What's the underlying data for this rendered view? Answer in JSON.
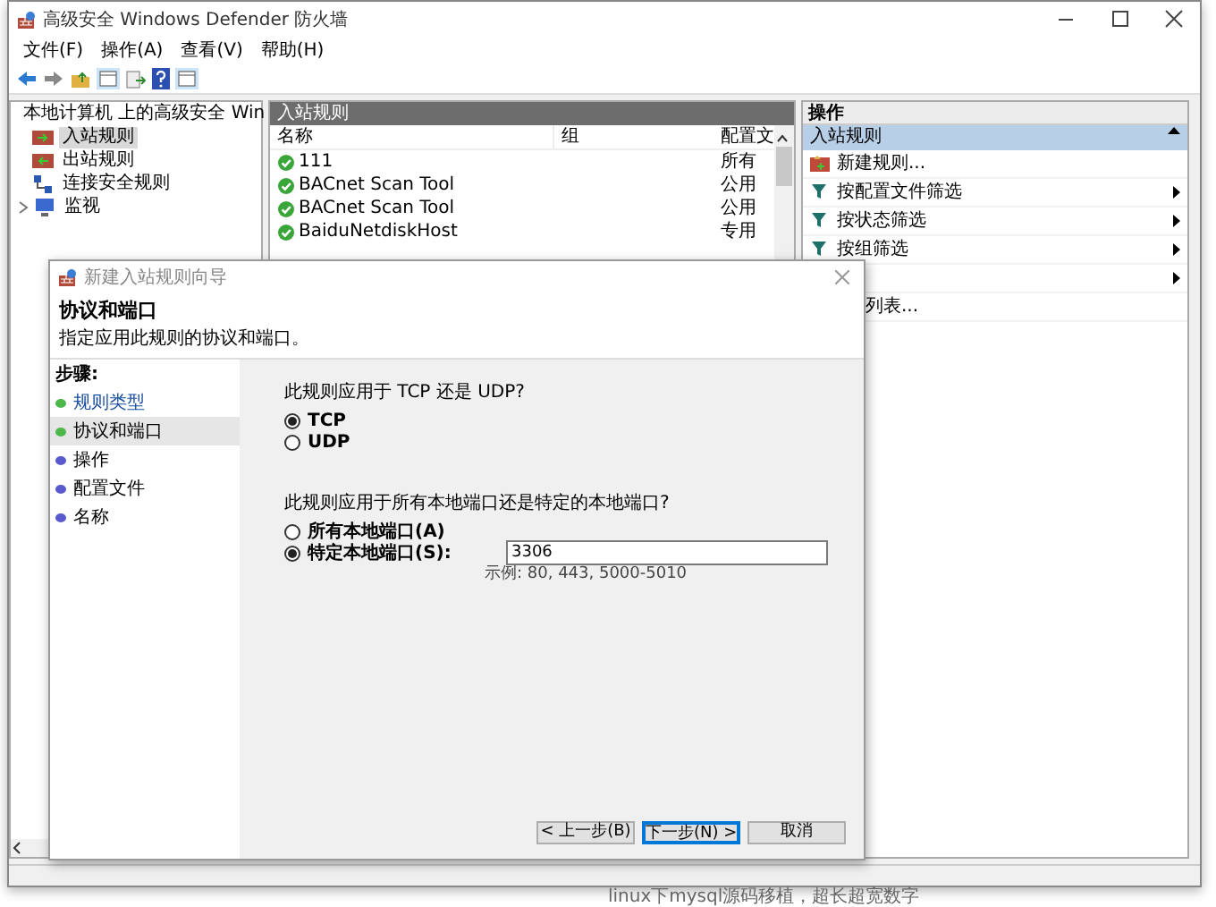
{
  "window": {
    "title": "高级安全 Windows Defender 防火墙"
  },
  "menu": [
    "文件(F)",
    "操作(A)",
    "查看(V)",
    "帮助(H)"
  ],
  "tree": {
    "root": "本地计算机 上的高级安全 Win",
    "items": [
      {
        "label": "入站规则",
        "selected": true,
        "kind": "inbound"
      },
      {
        "label": "出站规则",
        "selected": false,
        "kind": "outbound"
      },
      {
        "label": "连接安全规则",
        "selected": false,
        "kind": "security"
      },
      {
        "label": "监视",
        "selected": false,
        "kind": "monitor",
        "expanded": false
      }
    ]
  },
  "rules": {
    "title": "入站规则",
    "columns": [
      "名称",
      "组",
      "配置文"
    ],
    "rows": [
      {
        "name": "111",
        "profile": "所有"
      },
      {
        "name": "BACnet Scan Tool",
        "profile": "公用"
      },
      {
        "name": "BACnet Scan Tool",
        "profile": "公用"
      },
      {
        "name": "BaiduNetdiskHost",
        "profile": "专用"
      }
    ]
  },
  "actions": {
    "title": "操作",
    "section": {
      "title": "入站规则",
      "expanded": true
    },
    "items": [
      {
        "label": "新建规则...",
        "kind": "new",
        "submenu": false
      },
      {
        "label": "按配置文件筛选",
        "kind": "filter",
        "submenu": true
      },
      {
        "label": "按状态筛选",
        "kind": "filter",
        "submenu": true
      },
      {
        "label": "按组筛选",
        "kind": "filter",
        "submenu": true
      },
      {
        "kind": "hidden",
        "submenu": true
      },
      {
        "label": "列表...",
        "kind": "export",
        "submenu": false
      }
    ]
  },
  "dialog": {
    "title": "新建入站规则向导",
    "heading": "协议和端口",
    "description": "指定应用此规则的协议和端口。",
    "steps_title": "步骤:",
    "steps": [
      {
        "label": "规则类型",
        "done": true,
        "selected": false
      },
      {
        "label": "协议和端口",
        "done": true,
        "selected": true
      },
      {
        "label": "操作",
        "done": false,
        "selected": false
      },
      {
        "label": "配置文件",
        "done": false,
        "selected": false
      },
      {
        "label": "名称",
        "done": false,
        "selected": false
      }
    ],
    "protocol_question": "此规则应用于 TCP 还是 UDP?",
    "protocol_options": [
      {
        "label": "TCP",
        "selected": true
      },
      {
        "label": "UDP",
        "selected": false
      }
    ],
    "port_question": "此规则应用于所有本地端口还是特定的本地端口?",
    "port_options": [
      {
        "label": "所有本地端口(A)",
        "selected": false
      },
      {
        "label": "特定本地端口(S):",
        "selected": true
      }
    ],
    "port_value": "3306",
    "example": "示例: 80, 443, 5000-5010",
    "buttons": [
      {
        "label": "< 上一步(B)",
        "default": false
      },
      {
        "label": "下一步(N) >",
        "default": true
      },
      {
        "label": "取消",
        "default": false
      }
    ]
  },
  "background_text": "linux下mysql源码移植，超长超宽数字"
}
